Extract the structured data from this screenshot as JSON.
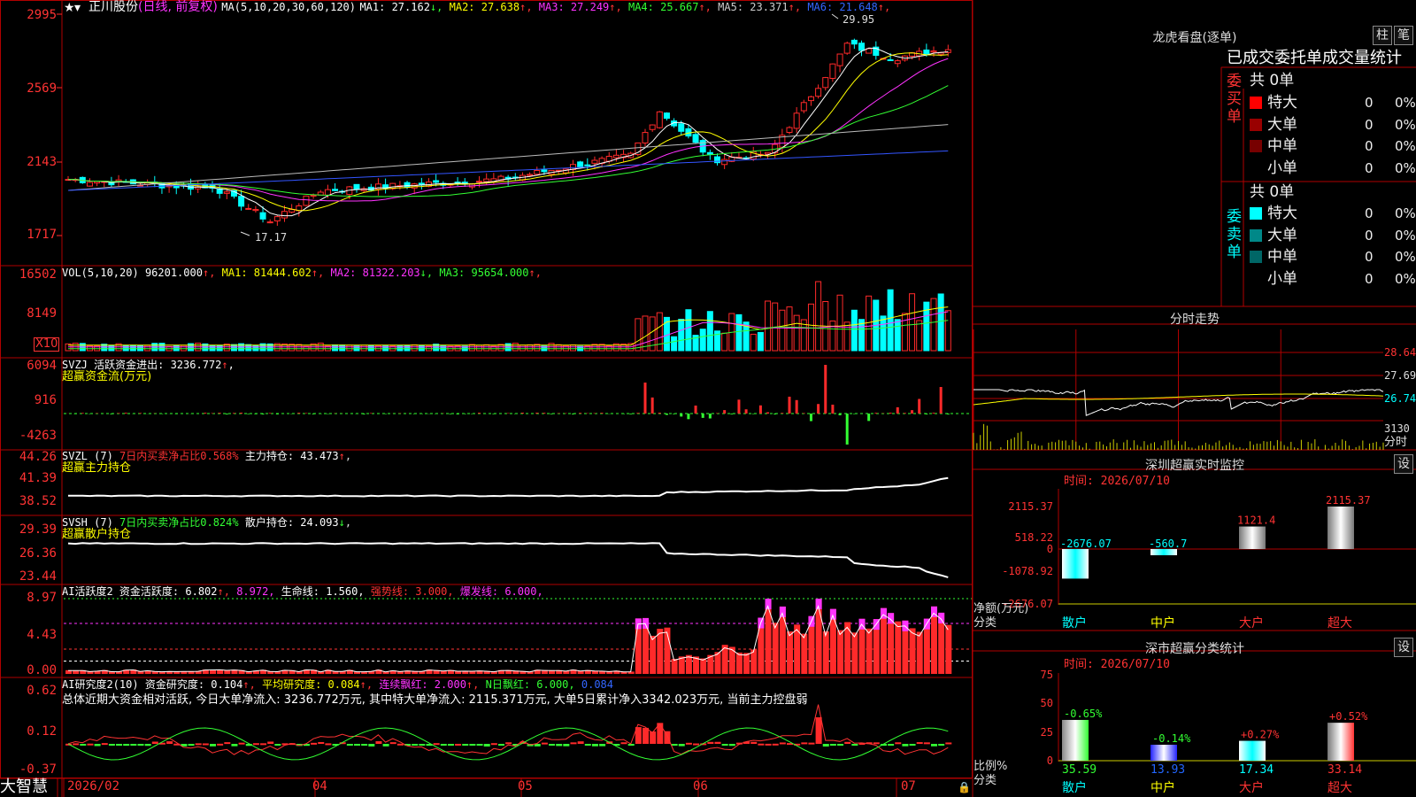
{
  "app": {
    "brand": "大智慧"
  },
  "header": {
    "stock": "正川股份",
    "mode": "(日线, 前复权)",
    "ma_label": "MA(5,10,20,30,60,120)",
    "ma": [
      {
        "label": "MA1: 27.162",
        "arrow": "↓",
        "color": "#ffffff"
      },
      {
        "label": "MA2: 27.638",
        "arrow": "↑",
        "color": "#ffff00"
      },
      {
        "label": "MA3: 27.249",
        "arrow": "↑",
        "color": "#ff33ff"
      },
      {
        "label": "MA4: 25.667",
        "arrow": "↑",
        "color": "#33ff33"
      },
      {
        "label": "MA5: 23.371",
        "arrow": "↑",
        "color": "#cccccc"
      },
      {
        "label": "MA6: 21.648",
        "arrow": "↑",
        "color": "#3366ff"
      }
    ],
    "high_label": "29.95",
    "low_label": "17.17"
  },
  "panels": {
    "price": {
      "ticks": [
        "2995",
        "2569",
        "2143",
        "1717"
      ]
    },
    "vol": {
      "ticks": [
        "16502",
        "8149"
      ],
      "x10": "X10",
      "label": "VOL(5,10,20)",
      "value": "96201.000",
      "ma": [
        {
          "label": "MA1: 81444.602",
          "arrow": "↑",
          "color": "#ffff00"
        },
        {
          "label": "MA2: 81322.203",
          "arrow": "↓",
          "color": "#ff33ff"
        },
        {
          "label": "MA3: 95654.000",
          "arrow": "↑",
          "color": "#33ff33"
        }
      ]
    },
    "svzj": {
      "ticks": [
        "6094",
        "916",
        "-4263"
      ],
      "line1": "SVZJ  活跃资金进出: 3236.772",
      "arrow": "↑",
      "line2": "超赢资金流(万元)"
    },
    "svzl": {
      "ticks": [
        "44.26",
        "41.39",
        "38.52"
      ],
      "a": "SVZL (7)",
      "b": "7日内买卖净占比0.568%",
      "c": "主力持仓: 43.473",
      "arrow": "↑",
      "line2": "超赢主力持仓"
    },
    "svsh": {
      "ticks": [
        "29.39",
        "26.36",
        "23.44"
      ],
      "a": "SVSH (7)",
      "b": "7日内买卖净占比0.824%",
      "c": "散户持仓: 24.093",
      "arrow": "↓",
      "line2": "超赢散户持仓"
    },
    "ai1": {
      "ticks": [
        "8.97",
        "4.43",
        "0.00"
      ],
      "a": "AI活跃度2",
      "b": "资金活跃度: 6.802",
      "c": "8.972,",
      "d": "生命线: 1.560,",
      "e": "强势线: 3.000,",
      "f": "爆发线: 6.000,"
    },
    "ai2": {
      "ticks": [
        "0.62",
        "0.12",
        "-0.37"
      ],
      "a": "AI研究度2(10)",
      "b": "资金研究度: 0.104",
      "c": "平均研究度: 0.084",
      "d": "连续飘红: 2.000",
      "e": "N日飘红: 6.000,",
      "f": "0.084",
      "summary": "总体近期大资金相对活跃, 今日大单净流入: 3236.772万元, 其中特大单净流入: 2115.371万元, 大单5日累计净入3342.023万元, 当前主力控盘弱"
    }
  },
  "xaxis": [
    "2026/02",
    "04",
    "05",
    "06",
    "07"
  ],
  "right": {
    "lhb_title": "龙虎看盘(逐单)",
    "btn_bar": "柱",
    "btn_bi": "笔",
    "tabs": "已成交委托单成交量统计",
    "buy": {
      "side": "委买单",
      "total": "共 0单",
      "rows": [
        {
          "name": "特大",
          "value": "0",
          "pct": "0%",
          "color": "#ff0000"
        },
        {
          "name": "大单",
          "value": "0",
          "pct": "0%",
          "color": "#990000"
        },
        {
          "name": "中单",
          "value": "0",
          "pct": "0%",
          "color": "#770000"
        },
        {
          "name": "小单",
          "value": "0",
          "pct": "0%",
          "color": "#000000"
        }
      ]
    },
    "sell": {
      "side": "委卖单",
      "total": "共 0单",
      "rows": [
        {
          "name": "特大",
          "value": "0",
          "pct": "0%",
          "color": "#00ffff"
        },
        {
          "name": "大单",
          "value": "0",
          "pct": "0%",
          "color": "#008888"
        },
        {
          "name": "中单",
          "value": "0",
          "pct": "0%",
          "color": "#006666"
        },
        {
          "name": "小单",
          "value": "0",
          "pct": "0%",
          "color": "#000000"
        }
      ]
    },
    "fenshi": {
      "title": "分时走势",
      "ticks": [
        "28.64",
        "27.69",
        "26.74"
      ],
      "vol_tick": "3130",
      "vol_label": "分时"
    },
    "monitor": {
      "title": "深圳超赢实时监控",
      "btn": "设",
      "time": "时间: 2026/07/10",
      "ticks": [
        "2115.37",
        "518.22",
        "0",
        "-1078.92",
        "-2676.07"
      ],
      "ylabel": "净额(万元)",
      "xlabel": "分类",
      "cats": [
        "散户",
        "中户",
        "大户",
        "超大"
      ],
      "values": [
        -2676.07,
        -560.7,
        1121.4,
        2115.37
      ],
      "value_labels": [
        "-2676.07",
        "-560.7",
        "1121.4",
        "2115.37"
      ]
    },
    "classify": {
      "title": "深市超赢分类统计",
      "btn": "设",
      "time": "时间: 2026/07/10",
      "ticks": [
        "75",
        "50",
        "25",
        "0"
      ],
      "ylabel": "比例%",
      "xlabel": "分类",
      "cats": [
        "散户",
        "中户",
        "大户",
        "超大"
      ],
      "pct": [
        35.59,
        13.93,
        17.34,
        33.14
      ],
      "pct_labels": [
        "35.59",
        "13.93",
        "17.34",
        "33.14"
      ],
      "chg_labels": [
        "-0.65%",
        "-0.14%",
        "+0.27%",
        "+0.52%"
      ]
    }
  },
  "colors": {
    "up": "#ff2a2a",
    "down": "#00ffff",
    "frame": "#b00000"
  }
}
